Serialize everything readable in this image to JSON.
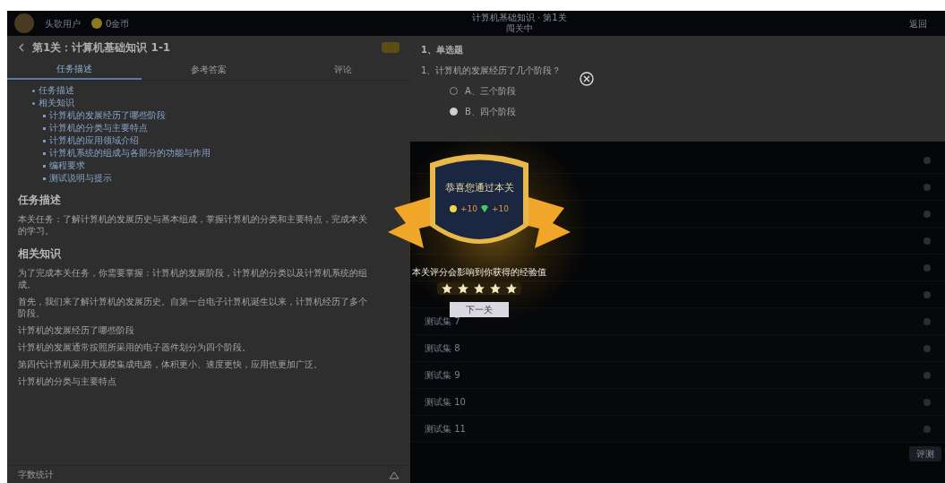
{
  "top_bar": {
    "user": "头歌用户",
    "coins": "0金币",
    "title": "计算机基础知识 · 第1关",
    "subtitle": "闯关中",
    "right": "返回"
  },
  "task": {
    "title": "第1关：计算机基础知识 1-1",
    "tabs": [
      {
        "label": "任务描述",
        "selected": true
      },
      {
        "label": "参考答案",
        "selected": false
      },
      {
        "label": "评论",
        "selected": false
      }
    ],
    "outline": [
      {
        "label": "任务描述"
      },
      {
        "label": "相关知识",
        "children": [
          {
            "label": "计算机的发展经历了哪些阶段"
          },
          {
            "label": "计算机的分类与主要特点"
          },
          {
            "label": "计算机的应用领域介绍"
          },
          {
            "label": "计算机系统的组成与各部分的功能与作用"
          },
          {
            "label": "编程要求"
          },
          {
            "label": "测试说明与提示"
          }
        ]
      }
    ],
    "sections": [
      {
        "kind": "heading",
        "text": "任务描述"
      },
      {
        "kind": "paragraph",
        "text": "本关任务：了解计算机的发展历史与基本组成，掌握计算机的分类和主要特点，完成本关的学习。"
      },
      {
        "kind": "heading",
        "text": "相关知识"
      },
      {
        "kind": "paragraph",
        "text": "为了完成本关任务，你需要掌握：计算机的发展阶段，计算机的分类以及计算机系统的组成。"
      },
      {
        "kind": "paragraph",
        "text": "首先，我们来了解计算机的发展历史。自第一台电子计算机诞生以来，计算机经历了多个阶段。"
      },
      {
        "kind": "paragraph",
        "text": "计算机的发展经历了哪些阶段"
      },
      {
        "kind": "paragraph",
        "text": "计算机的发展通常按照所采用的电子器件划分为四个阶段。"
      },
      {
        "kind": "paragraph",
        "text": "第四代计算机采用大规模集成电路，体积更小、速度更快，应用也更加广泛。"
      },
      {
        "kind": "paragraph",
        "text": "计算机的分类与主要特点"
      }
    ],
    "footer": "字数统计"
  },
  "quiz": {
    "heading": "1、单选题",
    "question": "1、计算机的发展经历了几个阶段？",
    "options": [
      {
        "label": "A、三个阶段",
        "selected": false
      },
      {
        "label": "B、四个阶段",
        "selected": true
      }
    ]
  },
  "tests": [
    {
      "label": "测试集 7"
    },
    {
      "label": "测试集 8"
    },
    {
      "label": "测试集 9"
    },
    {
      "label": "测试集 10"
    },
    {
      "label": "测试集 11"
    }
  ],
  "submit": "评测",
  "modal": {
    "title": "恭喜您通过本关",
    "rewards": [
      {
        "kind": "coin",
        "text": "+10"
      },
      {
        "kind": "gem",
        "text": "+10"
      }
    ],
    "message": "本关评分会影响到你获得的经验值",
    "stars": 5,
    "button": "下一关"
  }
}
